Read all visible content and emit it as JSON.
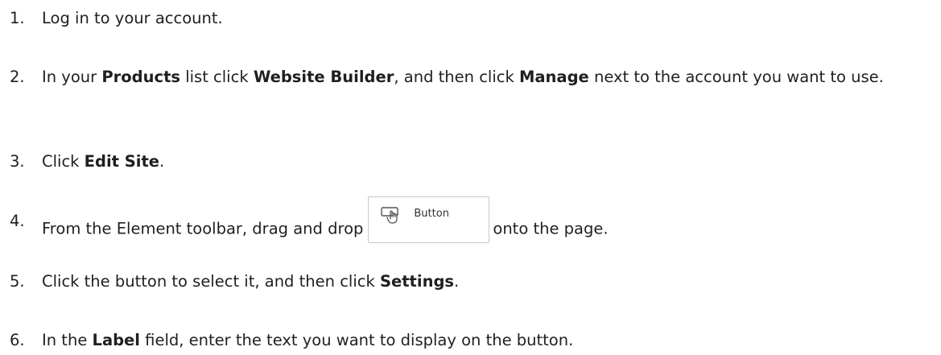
{
  "steps": [
    {
      "number": "1.",
      "parts": [
        {
          "text": "Log in to your account."
        }
      ]
    },
    {
      "number": "2.",
      "parts": [
        {
          "text": "In your "
        },
        {
          "text": "Products",
          "bold": true
        },
        {
          "text": " list click "
        },
        {
          "text": "Website Builder",
          "bold": true
        },
        {
          "text": ", and then click "
        },
        {
          "text": "Manage",
          "bold": true
        },
        {
          "text": " next to the account you want to use."
        }
      ]
    },
    {
      "number": "3.",
      "parts": [
        {
          "text": "Click "
        },
        {
          "text": "Edit Site",
          "bold": true
        },
        {
          "text": "."
        }
      ]
    },
    {
      "number": "4.",
      "before": "From the Element toolbar, drag and drop",
      "after": "onto the page.",
      "element_button": {
        "label": "Button",
        "icon": "button-element-icon"
      }
    },
    {
      "number": "5.",
      "parts": [
        {
          "text": "Click the button to select it, and then click "
        },
        {
          "text": "Settings",
          "bold": true
        },
        {
          "text": "."
        }
      ]
    },
    {
      "number": "6.",
      "parts": [
        {
          "text": "In the "
        },
        {
          "text": "Label",
          "bold": true
        },
        {
          "text": " field, enter the text you want to display on the button."
        }
      ]
    }
  ]
}
